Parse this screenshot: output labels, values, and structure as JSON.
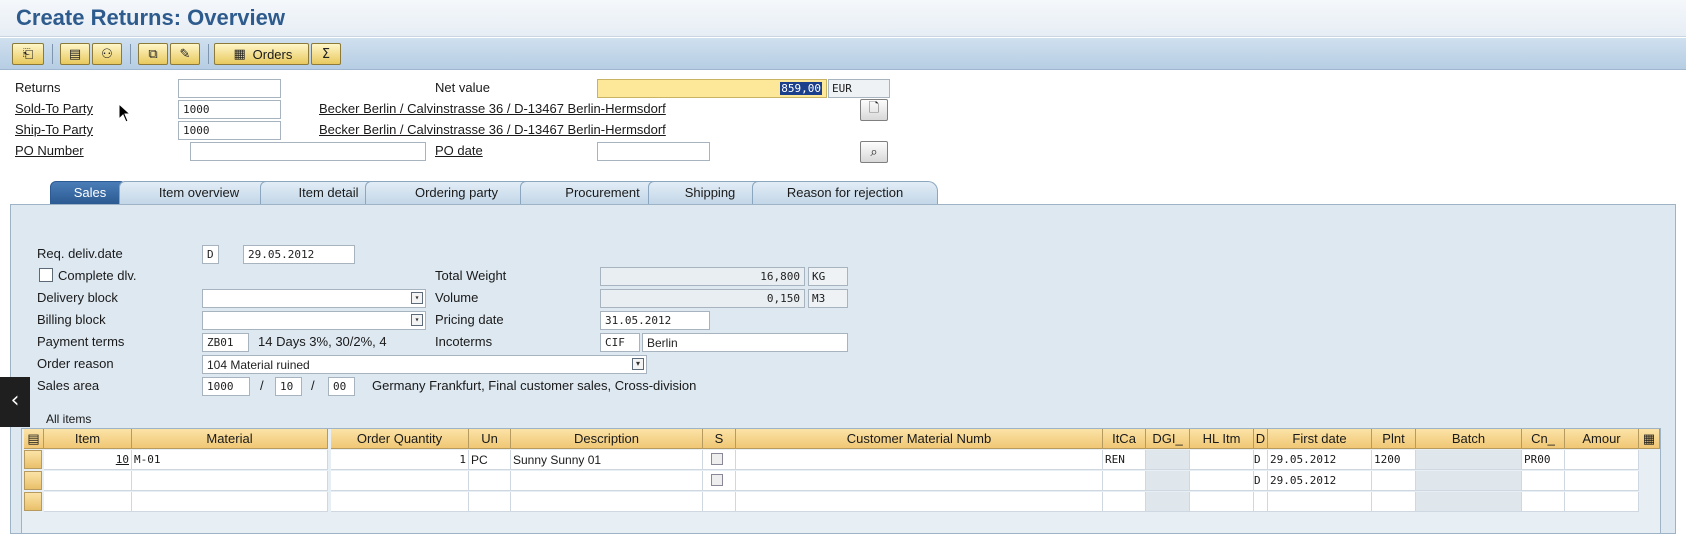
{
  "window": {
    "title": "Create Returns: Overview"
  },
  "toolbar": {
    "orders_label": "Orders",
    "icons": [
      "display-document-flow-icon",
      "header-details-icon",
      "business-partner-icon",
      "item-details-icon",
      "display-item-icon",
      "configure-icon",
      "orders-icon",
      "sum-icon"
    ]
  },
  "header": {
    "returns_label": "Returns",
    "returns_value": "",
    "net_value_label": "Net value",
    "net_value": "859,00",
    "net_value_currency": "EUR",
    "sold_to_label": "Sold-To Party",
    "sold_to_value": "1000",
    "sold_to_address": "Becker Berlin / Calvinstrasse 36 / D-13467 Berlin-Hermsdorf",
    "ship_to_label": "Ship-To Party",
    "ship_to_value": "1000",
    "ship_to_address": "Becker Berlin / Calvinstrasse 36 / D-13467 Berlin-Hermsdorf",
    "po_number_label": "PO Number",
    "po_number_value": "",
    "po_date_label": "PO date",
    "po_date_value": ""
  },
  "tabs": [
    {
      "label": "Sales",
      "active": true
    },
    {
      "label": "Item overview",
      "active": false
    },
    {
      "label": "Item detail",
      "active": false
    },
    {
      "label": "Ordering party",
      "active": false
    },
    {
      "label": "Procurement",
      "active": false
    },
    {
      "label": "Shipping",
      "active": false
    },
    {
      "label": "Reason for rejection",
      "active": false
    }
  ],
  "sales": {
    "req_deliv_date_label": "Req. deliv.date",
    "req_deliv_date_type": "D",
    "req_deliv_date": "29.05.2012",
    "complete_dlv_label": "Complete dlv.",
    "complete_dlv_checked": false,
    "total_weight_label": "Total Weight",
    "total_weight": "16,800",
    "total_weight_unit": "KG",
    "delivery_block_label": "Delivery block",
    "delivery_block_value": "",
    "volume_label": "Volume",
    "volume": "0,150",
    "volume_unit": "M3",
    "billing_block_label": "Billing block",
    "billing_block_value": "",
    "pricing_date_label": "Pricing date",
    "pricing_date": "31.05.2012",
    "payment_terms_label": "Payment terms",
    "payment_terms_code": "ZB01",
    "payment_terms_text": "14 Days 3%, 30/2%, 4",
    "incoterms_label": "Incoterms",
    "incoterms_code": "CIF",
    "incoterms_place": "Berlin",
    "order_reason_label": "Order reason",
    "order_reason_value": "104  Material ruined",
    "sales_area_label": "Sales area",
    "sales_org": "1000",
    "distr_channel": "10",
    "division": "00",
    "sales_area_sep": "/",
    "sales_area_text": "Germany Frankfurt, Final customer sales, Cross-division"
  },
  "items": {
    "title": "All items",
    "columns": [
      "Item",
      "Material",
      "Order Quantity",
      "Un",
      "Description",
      "S",
      "Customer Material Numb",
      "ItCa",
      "DGI_",
      "HL Itm",
      "D",
      "First date",
      "Plnt",
      "Batch",
      "Cn_",
      "Amour"
    ],
    "rows": [
      {
        "item": "10",
        "material": "M-01",
        "qty": "1",
        "un": "PC",
        "description": "Sunny Sunny 01",
        "itca": "REN",
        "d": "D",
        "first_date": "29.05.2012",
        "plnt": "1200",
        "cn": "PR00"
      },
      {
        "item": "",
        "material": "",
        "qty": "",
        "un": "",
        "description": "",
        "itca": "",
        "d": "D",
        "first_date": "29.05.2012",
        "plnt": "",
        "cn": ""
      }
    ]
  },
  "nav": {
    "back_glyph": "‹"
  }
}
